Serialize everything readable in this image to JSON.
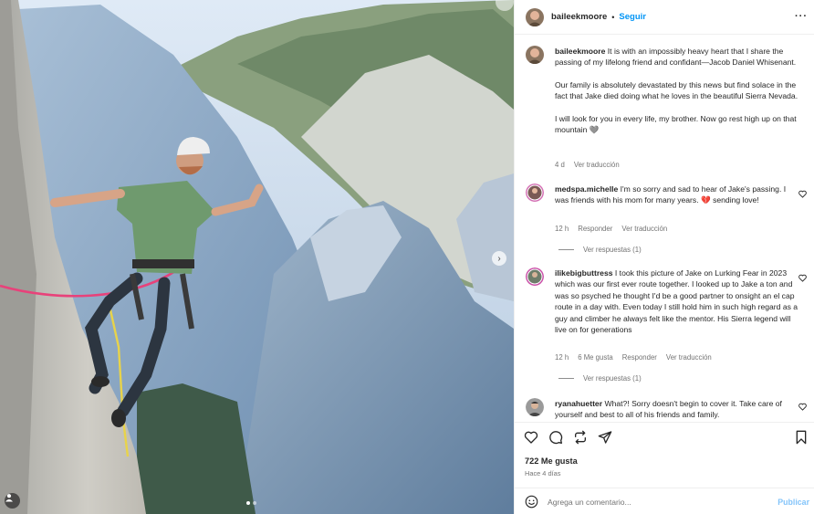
{
  "post": {
    "author": "baileekmoore",
    "follow_label": "Seguir",
    "separator": "•",
    "more_label": "···",
    "caption": {
      "username": "baileekmoore",
      "text": "It is with an impossibly heavy heart that I share the passing of my lifelong friend and confidant—Jacob Daniel Whisenant.",
      "paragraph2": "Our family is absolutely devastated by this news but find solace in the fact that Jake died doing what he loves in the beautiful Sierra Nevada.",
      "paragraph3": "I will look for you in every life, my brother. Now go rest high up on that mountain 🩶",
      "age": "4 d",
      "translate": "Ver traducción"
    }
  },
  "comments": [
    {
      "username": "medspa.michelle",
      "text": "I'm so sorry and sad to hear of Jake's passing. I was friends with his mom for many years. 💔 sending love!",
      "age": "12 h",
      "reply": "Responder",
      "translate": "Ver traducción",
      "replies": "Ver respuestas (1)"
    },
    {
      "username": "ilikebigbuttress",
      "text": "I took this picture of Jake on Lurking Fear in 2023 which was our first ever route together. I looked up to Jake a ton and was so psyched he thought I'd be a good partner to onsight an el cap route in a day with. Even today I still hold him in such high regard as a guy and climber he always felt like the mentor. His Sierra legend will live on for generations",
      "age": "12 h",
      "likes": "6 Me gusta",
      "reply": "Responder",
      "translate": "Ver traducción",
      "replies": "Ver respuestas (1)"
    },
    {
      "username": "ryanahuetter",
      "text": "What?! Sorry doesn't begin to cover it. Take care of yourself and best to all of his friends and family."
    }
  ],
  "footer": {
    "likes": "722 Me gusta",
    "posted": "Hace 4 días",
    "comment_placeholder": "Agrega un comentario...",
    "publish_label": "Publicar"
  },
  "icons": {
    "like": "heart-icon",
    "comment": "comment-icon",
    "repost": "repost-icon",
    "share": "share-icon",
    "save": "bookmark-icon",
    "emoji": "emoji-icon",
    "next": "chevron-right-icon",
    "tag": "person-icon"
  },
  "colors": {
    "link": "#0095f6",
    "publish": "#83c4fa",
    "muted": "#737373"
  },
  "carousel": {
    "slides": 2,
    "active": 1
  }
}
